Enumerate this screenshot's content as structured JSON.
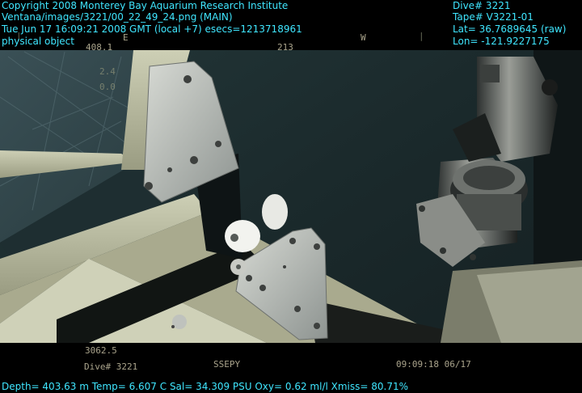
{
  "overlay": {
    "copyright": "Copyright 2008 Monterey Bay Aquarium Research Institute",
    "image_path": "Ventana/images/3221/00_22_49_24.png (MAIN)",
    "datetime": "Tue Jun 17 16:09:21 2008 GMT (local +7)  esecs=1213718961",
    "label": "physical object",
    "dive": "Dive# 3221",
    "tape": "Tape# V3221-01",
    "lat": "Lat= 36.7689645 (raw)",
    "lon": "Lon= -121.9227175",
    "sensors": "Depth= 403.63 m  Temp= 6.607 C  Sal= 34.309 PSU  Oxy= 0.62 ml/l  Xmiss= 80.71%"
  },
  "camera_hud": {
    "compass_e": "E",
    "compass_w": "W",
    "depth_top": "408.1",
    "heading": "213",
    "value_a": "2.4",
    "value_b": "0.0",
    "altitude": "3062.5",
    "dive": "Dive# 3221",
    "code": "SSEPY",
    "timestamp": "09:09:18 06/17"
  }
}
